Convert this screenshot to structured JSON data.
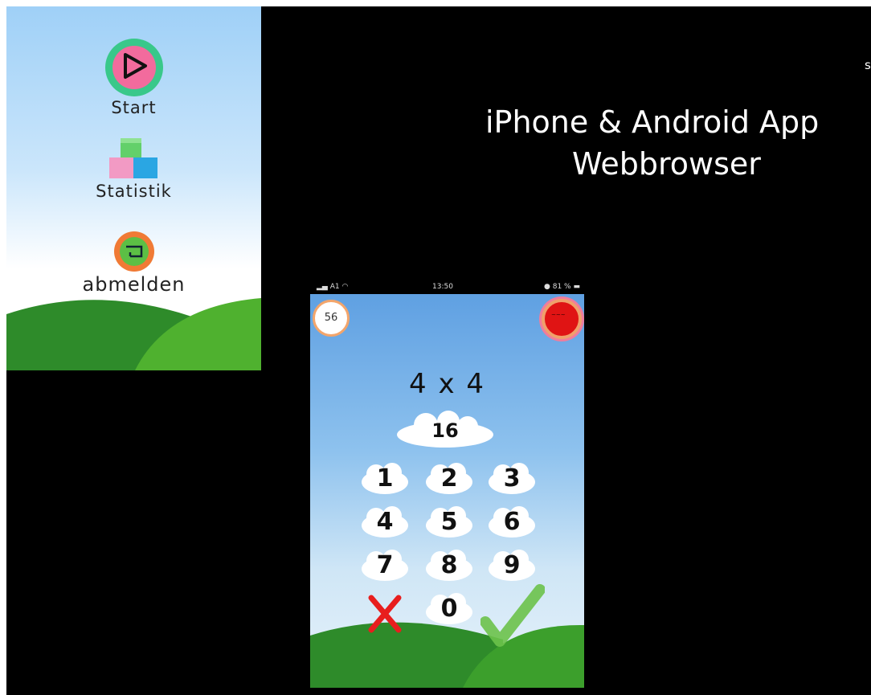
{
  "menu": {
    "start_label": "Start",
    "stats_label": "Statistik",
    "logout_label": "abmelden"
  },
  "slide": {
    "corner_letter": "s",
    "title": "iPhone & Android App",
    "subtitle": "Webbrowser"
  },
  "statusbar": {
    "carrier": "A1",
    "time": "13:50",
    "battery": "81 %"
  },
  "phone": {
    "timer": "56",
    "problem": "4 x 4",
    "answer": "16",
    "keys": [
      "1",
      "2",
      "3",
      "4",
      "5",
      "6",
      "7",
      "8",
      "9",
      "0"
    ]
  },
  "colors": {
    "start_ring": "#39c88a",
    "start_core": "#f26b9d",
    "logout_ring": "#f07a35",
    "logout_core": "#5cbf45",
    "hill_green": "#2f9a2c",
    "cancel": "#e81e1e",
    "confirm": "#6cc24a"
  }
}
